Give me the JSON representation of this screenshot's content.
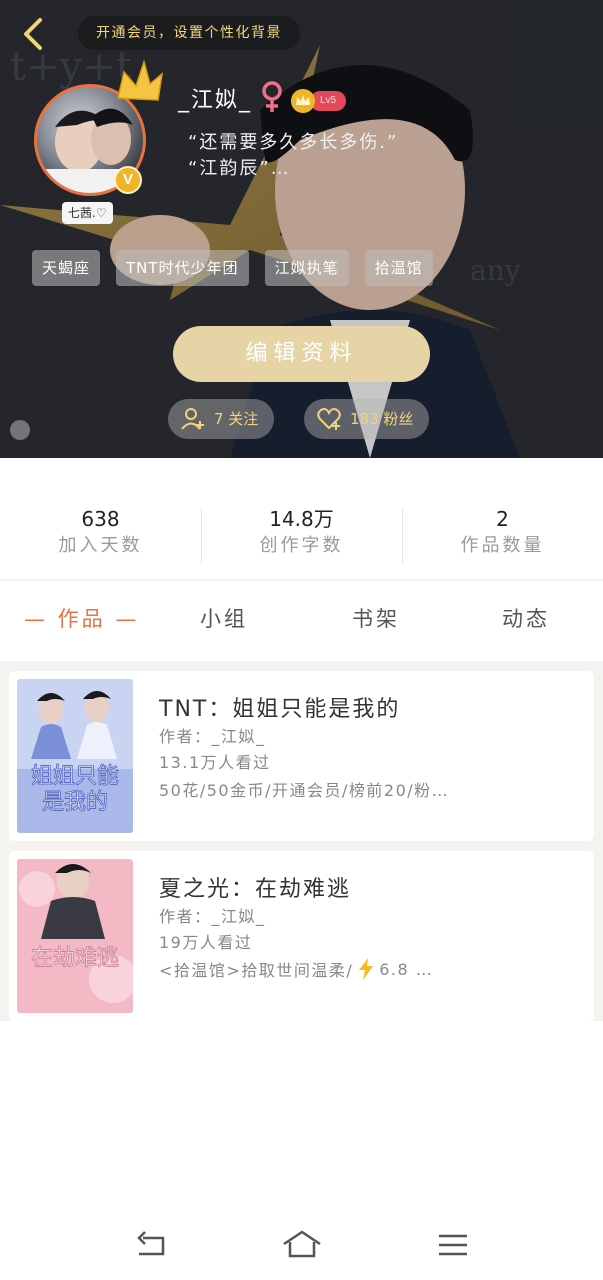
{
  "header": {
    "promo_text": "开通会员，设置个性化背景",
    "username": "_江姒_",
    "level": "Lv5",
    "motto_line1": "“还需要多久多长多伤.”",
    "motto_line2": "“江韵辰”…",
    "avatar_caption": "七茜.♡",
    "verified_mark": "V",
    "tags": [
      "天蝎座",
      "TNT时代少年团",
      "江姒执笔",
      "拾温馆"
    ],
    "edit_button": "编辑资料",
    "following": "7 关注",
    "followers": "183 粉丝",
    "colors": {
      "accent": "#e8733e",
      "gold": "#f3d37a",
      "edit_button_bg": "#e6d4a6"
    }
  },
  "stats": [
    {
      "value": "638",
      "label": "加入天数"
    },
    {
      "value": "14.8万",
      "label": "创作字数"
    },
    {
      "value": "2",
      "label": "作品数量"
    }
  ],
  "tabs": [
    {
      "label": "— 作品 —",
      "active": true
    },
    {
      "label": "小组",
      "active": false
    },
    {
      "label": "书架",
      "active": false
    },
    {
      "label": "动态",
      "active": false
    }
  ],
  "works": [
    {
      "title": "TNT：姐姐只能是我的",
      "author": "作者：_江姒_",
      "views": "13.1万人看过",
      "info": "50花/50金币/开通会员/榜前20/粉…",
      "cover_text": "姐姐只能是我的"
    },
    {
      "title": "夏之光：在劫难逃",
      "author": "作者：_江姒_",
      "views": "19万人看过",
      "info_prefix": "<拾温馆>拾取世间温柔/",
      "info_suffix": "6.8 …",
      "cover_text": "在劫难逃"
    }
  ],
  "nav": {
    "icons": [
      "back-icon",
      "home-icon",
      "menu-icon"
    ]
  }
}
